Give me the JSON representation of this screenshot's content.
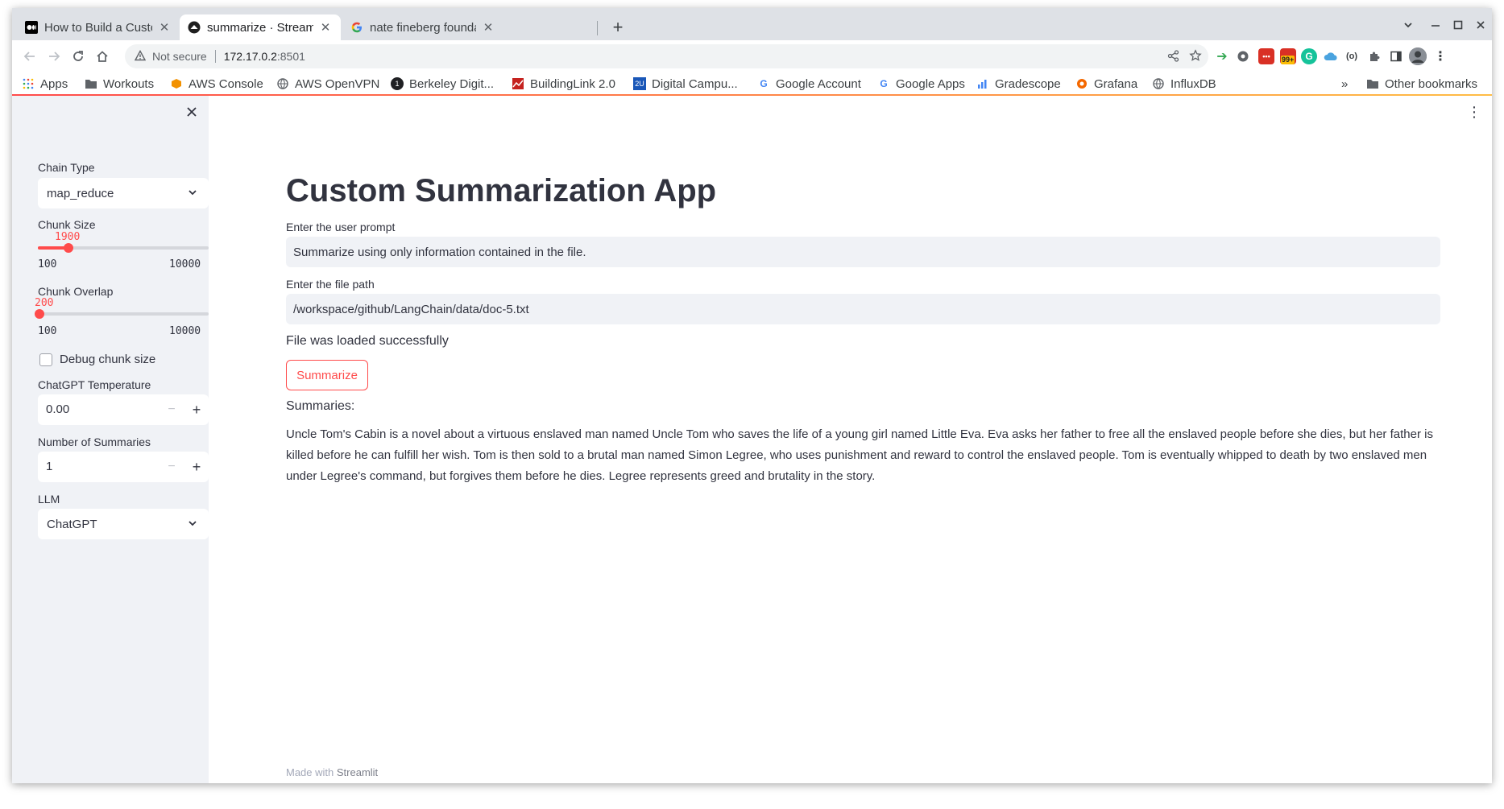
{
  "browser": {
    "tabs": [
      {
        "title": "How to Build a Custom Su",
        "favicon": "medium-icon"
      },
      {
        "title": "summarize · Streamlit",
        "favicon": "streamlit-icon"
      },
      {
        "title": "nate fineberg foundation",
        "favicon": "google-icon"
      }
    ],
    "address": {
      "security": "Not secure",
      "host": "172.17.0.2",
      "port": ":8501"
    },
    "extension_badge": "99+",
    "bookmarks": [
      "Apps",
      "Workouts",
      "AWS Console",
      "AWS OpenVPN",
      "Berkeley Digit...",
      "BuildingLink 2.0",
      "Digital Campu...",
      "Google Account",
      "Google Apps",
      "Gradescope",
      "Grafana",
      "InfluxDB"
    ],
    "other_bookmarks": "Other bookmarks",
    "overflow": "»"
  },
  "sidebar": {
    "chain_type": {
      "label": "Chain Type",
      "value": "map_reduce"
    },
    "chunk_size": {
      "label": "Chunk Size",
      "value": "1900",
      "min": "100",
      "max": "10000"
    },
    "chunk_overlap": {
      "label": "Chunk Overlap",
      "value": "200",
      "min": "100",
      "max": "10000"
    },
    "debug": {
      "label": "Debug chunk size",
      "checked": false
    },
    "temperature": {
      "label": "ChatGPT Temperature",
      "value": "0.00"
    },
    "num_summaries": {
      "label": "Number of Summaries",
      "value": "1"
    },
    "llm": {
      "label": "LLM",
      "value": "ChatGPT"
    }
  },
  "main": {
    "title": "Custom Summarization App",
    "prompt": {
      "label": "Enter the user prompt",
      "value": "Summarize using only information contained in the file."
    },
    "file": {
      "label": "Enter the file path",
      "value": "/workspace/github/LangChain/data/doc-5.txt"
    },
    "status": "File was loaded successfully",
    "button": "Summarize",
    "summaries_label": "Summaries:",
    "summary_text": "Uncle Tom's Cabin is a novel about a virtuous enslaved man named Uncle Tom who saves the life of a young girl named Little Eva. Eva asks her father to free all the enslaved people before she dies, but her father is killed before he can fulfill her wish. Tom is then sold to a brutal man named Simon Legree, who uses punishment and reward to control the enslaved people. Tom is eventually whipped to death by two enslaved men under Legree's command, but forgives them before he dies. Legree represents greed and brutality in the story.",
    "footer_prefix": "Made with",
    "footer_brand": "Streamlit"
  },
  "colors": {
    "accent": "#ff4b4b",
    "sidebar_bg": "#f0f2f6",
    "text": "#31333f"
  }
}
